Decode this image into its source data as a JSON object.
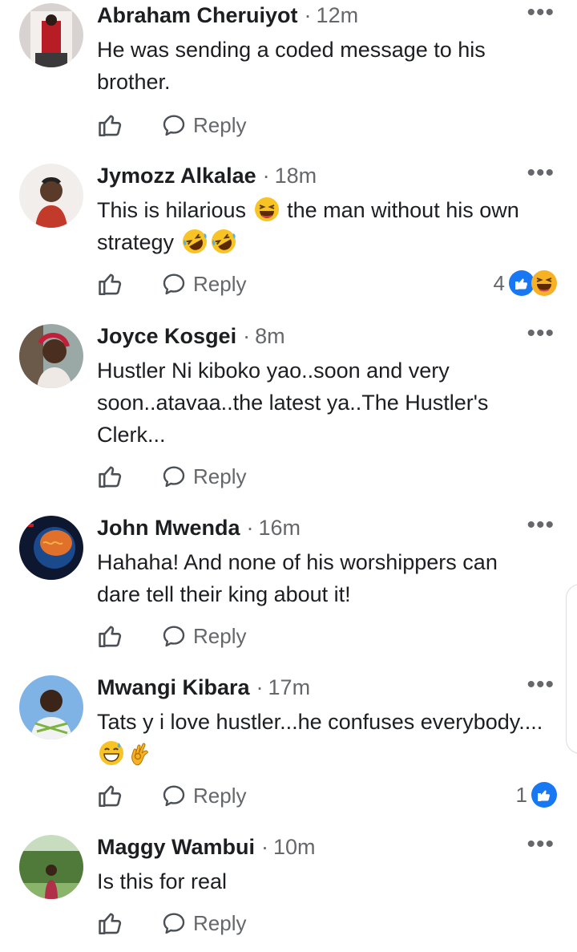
{
  "actions": {
    "reply_label": "Reply"
  },
  "comments": [
    {
      "name": "Abraham Cheruiyot",
      "time": "12m",
      "text": "He was sending a coded message to his brother.",
      "reaction_count": ""
    },
    {
      "name": "Jymozz Alkalae",
      "time": "18m",
      "text_a": "This is hilarious",
      "text_b": "the man without his own strategy",
      "reaction_count": "4"
    },
    {
      "name": "Joyce Kosgei",
      "time": "8m",
      "text": "Hustler Ni kiboko yao..soon and very soon..atavaa..the latest ya..The Hustler's Clerk...",
      "reaction_count": ""
    },
    {
      "name": "John Mwenda",
      "time": "16m",
      "text": "Hahaha! And none of his worshippers can dare tell their king about it!",
      "reaction_count": ""
    },
    {
      "name": "Mwangi Kibara",
      "time": "17m",
      "text": "Tats y i love hustler...he confuses everybody....",
      "reaction_count": "1"
    },
    {
      "name": "Maggy Wambui",
      "time": "10m",
      "text": "Is this for real",
      "reaction_count": ""
    }
  ],
  "icons": {
    "like": "thumbs-up-outline-icon",
    "reply": "speech-bubble-icon",
    "more": "more-horizontal-icon",
    "laugh_emoji": "laughing-face-emoji",
    "rofl_emoji": "rolling-on-floor-laughing-emoji",
    "sweat_emoji": "grinning-sweat-emoji",
    "ok_emoji": "ok-hand-emoji"
  },
  "colors": {
    "like_blue": "#1877f2",
    "muted": "#65676b",
    "text": "#1c1e21",
    "reaction_yellow": "#f7b125"
  }
}
